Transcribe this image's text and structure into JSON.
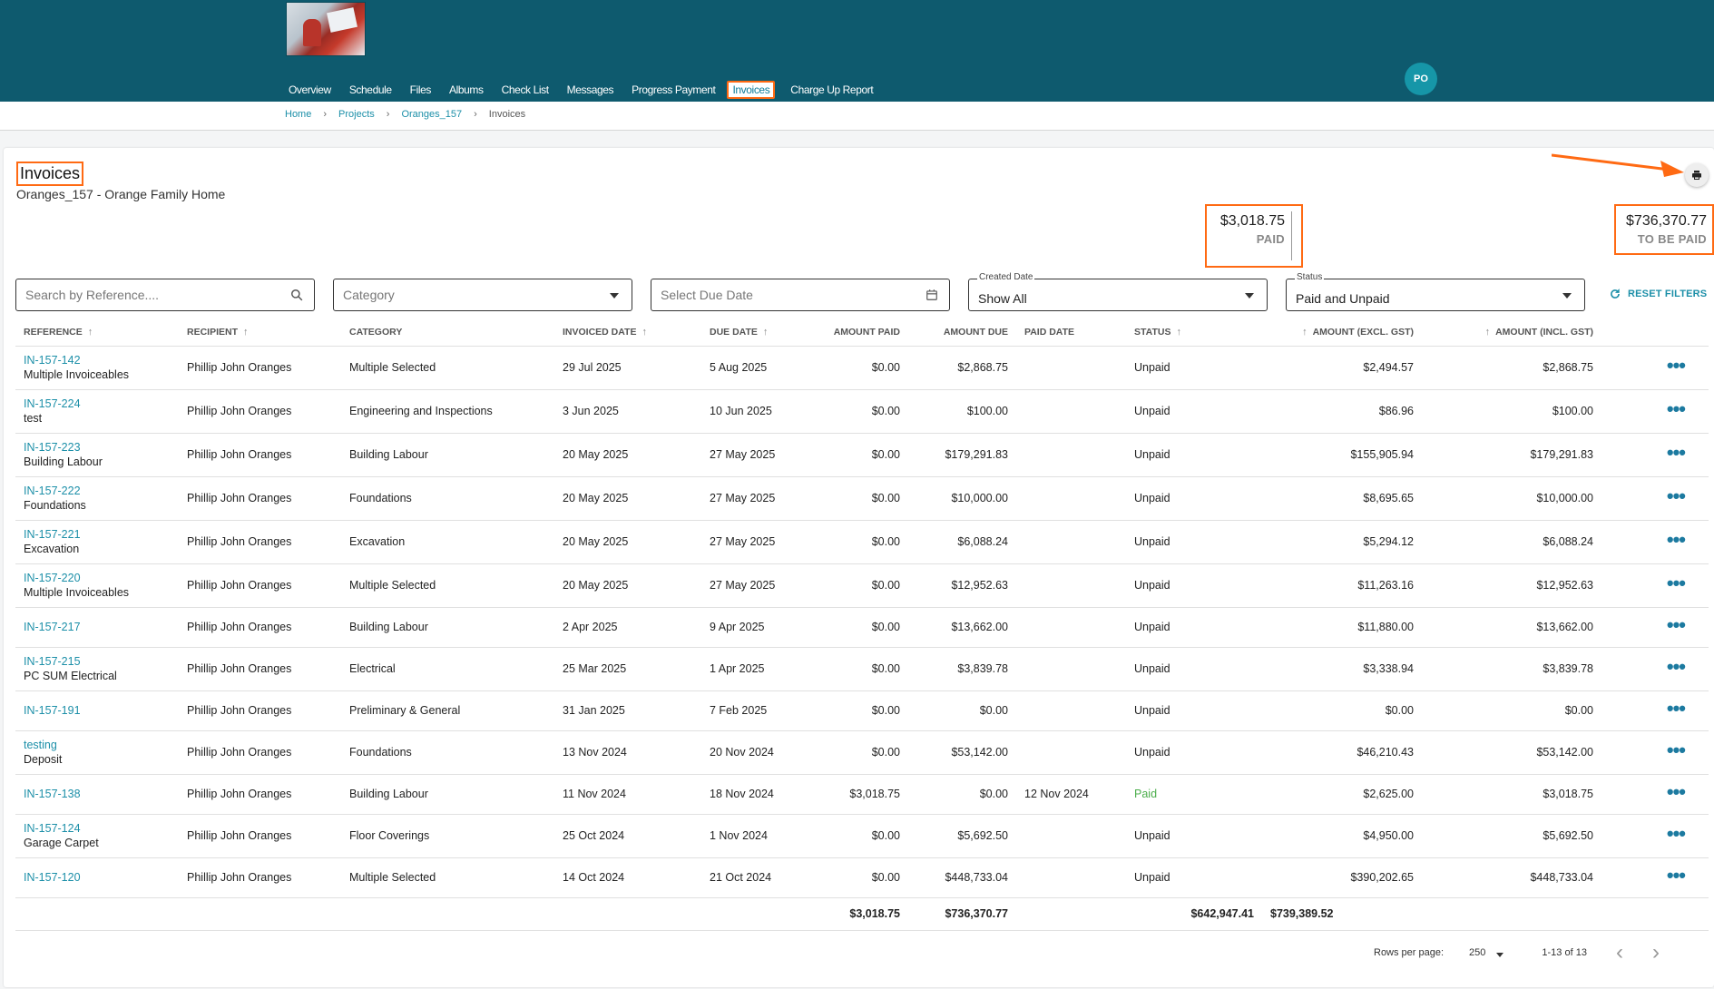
{
  "nav": {
    "items": [
      "Overview",
      "Schedule",
      "Files",
      "Albums",
      "Check List",
      "Messages",
      "Progress Payment",
      "Invoices",
      "Charge Up Report"
    ],
    "active": "Invoices"
  },
  "user": {
    "initials": "PO"
  },
  "breadcrumb": {
    "home": "Home",
    "projects": "Projects",
    "project": "Oranges_157",
    "current": "Invoices"
  },
  "page": {
    "title": "Invoices",
    "subtitle": "Oranges_157 - Orange Family Home"
  },
  "summary": {
    "paid_amount": "$3,018.75",
    "paid_label": "PAID",
    "due_amount": "$736,370.77",
    "due_label": "TO BE PAID"
  },
  "filters": {
    "search_placeholder": "Search by Reference....",
    "category_placeholder": "Category",
    "due_date_placeholder": "Select Due Date",
    "created_date_label": "Created Date",
    "created_date_value": "Show All",
    "status_label": "Status",
    "status_value": "Paid and Unpaid",
    "reset_label": "RESET FILTERS"
  },
  "table": {
    "headers": {
      "reference": "REFERENCE",
      "recipient": "RECIPIENT",
      "category": "CATEGORY",
      "invoiced_date": "INVOICED DATE",
      "due_date": "DUE DATE",
      "amount_paid": "AMOUNT PAID",
      "amount_due": "AMOUNT DUE",
      "paid_date": "PAID DATE",
      "status": "STATUS",
      "amount_excl": "AMOUNT (EXCL. GST)",
      "amount_incl": "AMOUNT (INCL. GST)"
    },
    "rows": [
      {
        "ref": "IN-157-142",
        "desc": "Multiple Invoiceables",
        "recipient": "Phillip John Oranges",
        "category": "Multiple Selected",
        "invoiced": "29 Jul 2025",
        "due": "5 Aug 2025",
        "paid_amt": "$0.00",
        "due_amt": "$2,868.75",
        "paid_date": "",
        "status": "Unpaid",
        "excl": "$2,494.57",
        "incl": "$2,868.75"
      },
      {
        "ref": "IN-157-224",
        "desc": "test",
        "recipient": "Phillip John Oranges",
        "category": "Engineering and Inspections",
        "invoiced": "3 Jun 2025",
        "due": "10 Jun 2025",
        "paid_amt": "$0.00",
        "due_amt": "$100.00",
        "paid_date": "",
        "status": "Unpaid",
        "excl": "$86.96",
        "incl": "$100.00"
      },
      {
        "ref": "IN-157-223",
        "desc": "Building Labour",
        "recipient": "Phillip John Oranges",
        "category": "Building Labour",
        "invoiced": "20 May 2025",
        "due": "27 May 2025",
        "paid_amt": "$0.00",
        "due_amt": "$179,291.83",
        "paid_date": "",
        "status": "Unpaid",
        "excl": "$155,905.94",
        "incl": "$179,291.83"
      },
      {
        "ref": "IN-157-222",
        "desc": "Foundations",
        "recipient": "Phillip John Oranges",
        "category": "Foundations",
        "invoiced": "20 May 2025",
        "due": "27 May 2025",
        "paid_amt": "$0.00",
        "due_amt": "$10,000.00",
        "paid_date": "",
        "status": "Unpaid",
        "excl": "$8,695.65",
        "incl": "$10,000.00"
      },
      {
        "ref": "IN-157-221",
        "desc": "Excavation",
        "recipient": "Phillip John Oranges",
        "category": "Excavation",
        "invoiced": "20 May 2025",
        "due": "27 May 2025",
        "paid_amt": "$0.00",
        "due_amt": "$6,088.24",
        "paid_date": "",
        "status": "Unpaid",
        "excl": "$5,294.12",
        "incl": "$6,088.24"
      },
      {
        "ref": "IN-157-220",
        "desc": "Multiple Invoiceables",
        "recipient": "Phillip John Oranges",
        "category": "Multiple Selected",
        "invoiced": "20 May 2025",
        "due": "27 May 2025",
        "paid_amt": "$0.00",
        "due_amt": "$12,952.63",
        "paid_date": "",
        "status": "Unpaid",
        "excl": "$11,263.16",
        "incl": "$12,952.63"
      },
      {
        "ref": "IN-157-217",
        "desc": "",
        "recipient": "Phillip John Oranges",
        "category": "Building Labour",
        "invoiced": "2 Apr 2025",
        "due": "9 Apr 2025",
        "paid_amt": "$0.00",
        "due_amt": "$13,662.00",
        "paid_date": "",
        "status": "Unpaid",
        "excl": "$11,880.00",
        "incl": "$13,662.00"
      },
      {
        "ref": "IN-157-215",
        "desc": "PC SUM Electrical",
        "recipient": "Phillip John Oranges",
        "category": "Electrical",
        "invoiced": "25 Mar 2025",
        "due": "1 Apr 2025",
        "paid_amt": "$0.00",
        "due_amt": "$3,839.78",
        "paid_date": "",
        "status": "Unpaid",
        "excl": "$3,338.94",
        "incl": "$3,839.78"
      },
      {
        "ref": "IN-157-191",
        "desc": "",
        "recipient": "Phillip John Oranges",
        "category": "Preliminary & General",
        "invoiced": "31 Jan 2025",
        "due": "7 Feb 2025",
        "paid_amt": "$0.00",
        "due_amt": "$0.00",
        "paid_date": "",
        "status": "Unpaid",
        "excl": "$0.00",
        "incl": "$0.00"
      },
      {
        "ref": "testing",
        "desc": "Deposit",
        "recipient": "Phillip John Oranges",
        "category": "Foundations",
        "invoiced": "13 Nov 2024",
        "due": "20 Nov 2024",
        "paid_amt": "$0.00",
        "due_amt": "$53,142.00",
        "paid_date": "",
        "status": "Unpaid",
        "excl": "$46,210.43",
        "incl": "$53,142.00"
      },
      {
        "ref": "IN-157-138",
        "desc": "",
        "recipient": "Phillip John Oranges",
        "category": "Building Labour",
        "invoiced": "11 Nov 2024",
        "due": "18 Nov 2024",
        "paid_amt": "$3,018.75",
        "due_amt": "$0.00",
        "paid_date": "12 Nov 2024",
        "status": "Paid",
        "excl": "$2,625.00",
        "incl": "$3,018.75"
      },
      {
        "ref": "IN-157-124",
        "desc": "Garage Carpet",
        "recipient": "Phillip John Oranges",
        "category": "Floor Coverings",
        "invoiced": "25 Oct 2024",
        "due": "1 Nov 2024",
        "paid_amt": "$0.00",
        "due_amt": "$5,692.50",
        "paid_date": "",
        "status": "Unpaid",
        "excl": "$4,950.00",
        "incl": "$5,692.50"
      },
      {
        "ref": "IN-157-120",
        "desc": "",
        "recipient": "Phillip John Oranges",
        "category": "Multiple Selected",
        "invoiced": "14 Oct 2024",
        "due": "21 Oct 2024",
        "paid_amt": "$0.00",
        "due_amt": "$448,733.04",
        "paid_date": "",
        "status": "Unpaid",
        "excl": "$390,202.65",
        "incl": "$448,733.04"
      }
    ],
    "totals": {
      "paid": "$3,018.75",
      "due": "$736,370.77",
      "excl": "$642,947.41",
      "incl": "$739,389.52"
    }
  },
  "pager": {
    "rows_per_page_label": "Rows per page:",
    "rows_per_page": "250",
    "range": "1-13 of 13"
  },
  "colors": {
    "header_bg": "#0e5a6e",
    "accent": "#1c8fa8",
    "highlight": "#ff6a13",
    "paid": "#4cae4c"
  },
  "icons": {
    "print": "printer-icon",
    "search": "search-icon",
    "calendar": "calendar-icon",
    "reset": "refresh-icon",
    "more": "more-horizontal-icon"
  }
}
